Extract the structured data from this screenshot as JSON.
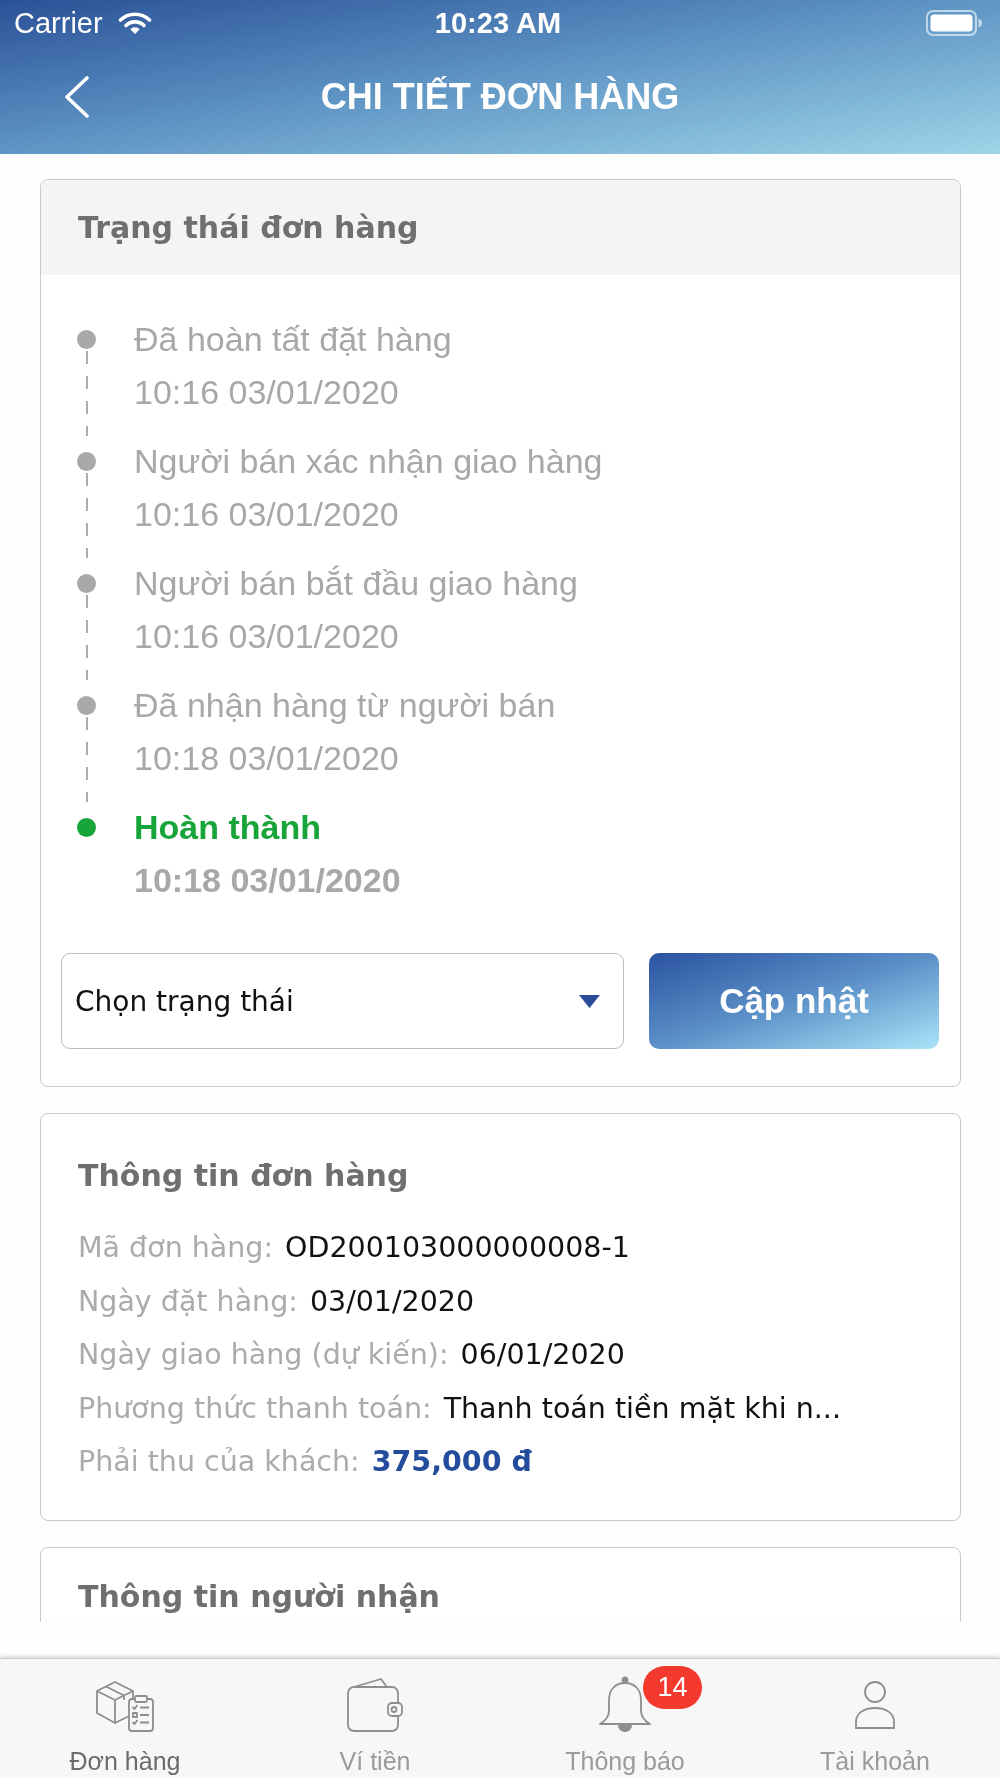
{
  "status_bar": {
    "carrier": "Carrier",
    "time": "10:23 AM"
  },
  "header": {
    "title": "CHI TIẾT ĐƠN HÀNG"
  },
  "order_status": {
    "title": "Trạng thái đơn hàng",
    "timeline": [
      {
        "label": "Đã hoàn tất đặt hàng",
        "time": "10:16 03/01/2020",
        "current": false
      },
      {
        "label": "Người bán xác nhận giao hàng",
        "time": "10:16 03/01/2020",
        "current": false
      },
      {
        "label": "Người bán bắt đầu giao hàng",
        "time": "10:16 03/01/2020",
        "current": false
      },
      {
        "label": "Đã nhận hàng từ người bán",
        "time": "10:18 03/01/2020",
        "current": false
      },
      {
        "label": "Hoàn thành",
        "time": "10:18 03/01/2020",
        "current": true
      }
    ],
    "status_select": {
      "placeholder": "Chọn trạng thái"
    },
    "update_button": {
      "label": "Cập nhật"
    }
  },
  "order_info": {
    "title": "Thông tin đơn hàng",
    "rows": [
      {
        "label": "Mã đơn hàng:",
        "value": "OD200103000000008-1",
        "kind": "text"
      },
      {
        "label": "Ngày đặt hàng:",
        "value": "03/01/2020",
        "kind": "text"
      },
      {
        "label": "Ngày giao hàng (dự kiến):",
        "value": "06/01/2020",
        "kind": "text"
      },
      {
        "label": "Phương thức thanh toán:",
        "value": "Thanh toán tiền mặt khi n...",
        "kind": "text"
      },
      {
        "label": "Phải thu của khách:",
        "value": "375,000 đ",
        "kind": "amount"
      }
    ]
  },
  "recipient_info": {
    "title": "Thông tin người nhận"
  },
  "tab_bar": {
    "tabs": [
      {
        "label": "Đơn hàng",
        "selected": true
      },
      {
        "label": "Ví tiền",
        "selected": false
      },
      {
        "label": "Thông báo",
        "selected": false,
        "badge": "14"
      },
      {
        "label": "Tài khoản",
        "selected": false
      }
    ]
  }
}
